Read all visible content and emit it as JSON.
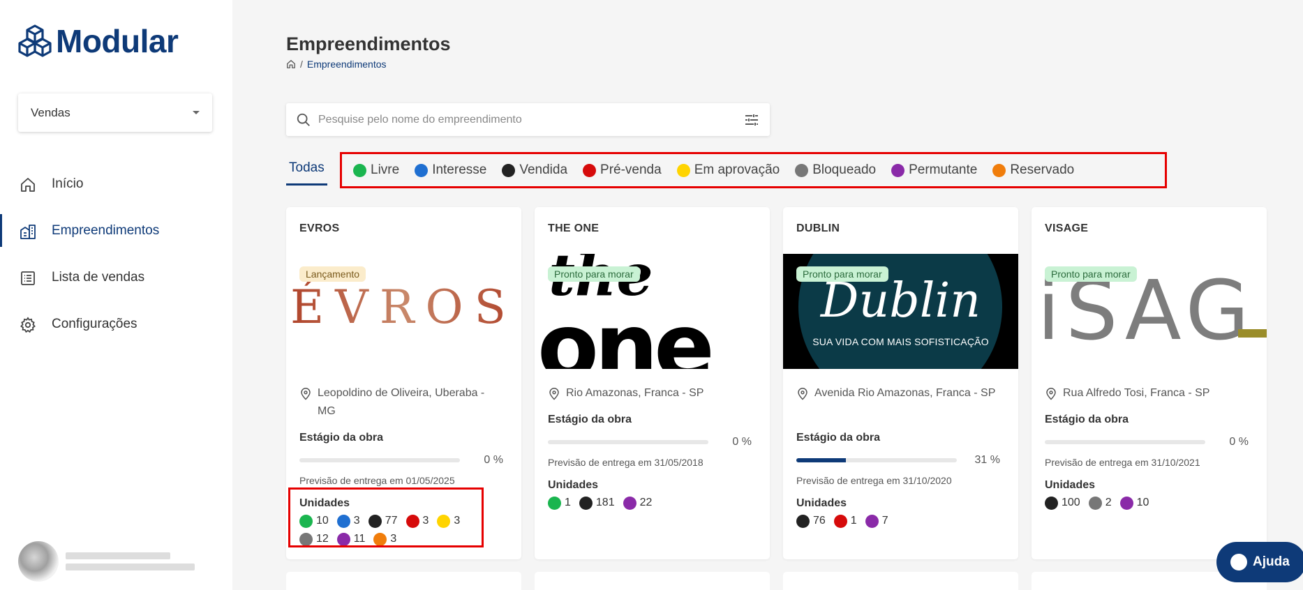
{
  "app": {
    "logo_text": "Modular"
  },
  "sidebar": {
    "select_value": "Vendas",
    "items": [
      {
        "label": "Início",
        "icon": "home-icon"
      },
      {
        "label": "Empreendimentos",
        "icon": "buildings-icon",
        "active": true
      },
      {
        "label": "Lista de vendas",
        "icon": "list-icon"
      },
      {
        "label": "Configurações",
        "icon": "gear-icon"
      }
    ]
  },
  "header": {
    "title": "Empreendimentos",
    "breadcrumb": "Empreendimentos",
    "breadcrumb_separator": "/"
  },
  "search": {
    "placeholder": "Pesquise pelo nome do empreendimento",
    "value": ""
  },
  "tabs": {
    "all": "Todas",
    "statuses": [
      {
        "label": "Livre",
        "color": "#1ab54f"
      },
      {
        "label": "Interesse",
        "color": "#1f6fd1"
      },
      {
        "label": "Vendida",
        "color": "#222222"
      },
      {
        "label": "Pré-venda",
        "color": "#d60b0b"
      },
      {
        "label": "Em aprovação",
        "color": "#ffd400"
      },
      {
        "label": "Bloqueado",
        "color": "#777777"
      },
      {
        "label": "Permutante",
        "color": "#8a2aa8"
      },
      {
        "label": "Reservado",
        "color": "#f07d0b"
      }
    ]
  },
  "cards": [
    {
      "title": "EVROS",
      "badge": "Lançamento",
      "image_text": "ÉVROS",
      "location": "Leopoldino de Oliveira, Uberaba - MG",
      "stage_label": "Estágio da obra",
      "progress": 0,
      "progress_text": "0 %",
      "delivery": "Previsão de entrega em 01/05/2025",
      "units_label": "Unidades",
      "units": [
        {
          "count": "10",
          "color": "#1ab54f"
        },
        {
          "count": "3",
          "color": "#1f6fd1"
        },
        {
          "count": "77",
          "color": "#222222"
        },
        {
          "count": "3",
          "color": "#d60b0b"
        },
        {
          "count": "3",
          "color": "#ffd400"
        },
        {
          "count": "12",
          "color": "#777777"
        },
        {
          "count": "11",
          "color": "#8a2aa8"
        },
        {
          "count": "3",
          "color": "#f07d0b"
        }
      ]
    },
    {
      "title": "THE ONE",
      "badge": "Pronto para morar",
      "image_text_1": "the",
      "image_text_2": "one",
      "location": "Rio Amazonas, Franca - SP",
      "stage_label": "Estágio da obra",
      "progress": 0,
      "progress_text": "0 %",
      "delivery": "Previsão de entrega em 31/05/2018",
      "units_label": "Unidades",
      "units": [
        {
          "count": "1",
          "color": "#1ab54f"
        },
        {
          "count": "181",
          "color": "#222222"
        },
        {
          "count": "22",
          "color": "#8a2aa8"
        }
      ]
    },
    {
      "title": "DUBLIN",
      "badge": "Pronto para morar",
      "image_text": "Dublin",
      "image_tagline": "SUA VIDA COM MAIS SOFISTICAÇÃO",
      "location": "Avenida Rio Amazonas, Franca - SP",
      "stage_label": "Estágio da obra",
      "progress": 31,
      "progress_text": "31 %",
      "delivery": "Previsão de entrega em 31/10/2020",
      "units_label": "Unidades",
      "units": [
        {
          "count": "76",
          "color": "#222222"
        },
        {
          "count": "1",
          "color": "#d60b0b"
        },
        {
          "count": "7",
          "color": "#8a2aa8"
        }
      ]
    },
    {
      "title": "VISAGE",
      "badge": "Pronto para morar",
      "image_text": "iSAG",
      "location": "Rua Alfredo Tosi, Franca - SP",
      "stage_label": "Estágio da obra",
      "progress": 0,
      "progress_text": "0 %",
      "delivery": "Previsão de entrega em 31/10/2021",
      "units_label": "Unidades",
      "units": [
        {
          "count": "100",
          "color": "#222222"
        },
        {
          "count": "2",
          "color": "#777777"
        },
        {
          "count": "10",
          "color": "#8a2aa8"
        }
      ]
    }
  ],
  "help_button": {
    "label": "Ajuda"
  },
  "colors": {
    "brand": "#0e3a78",
    "highlight": "#e60000"
  }
}
